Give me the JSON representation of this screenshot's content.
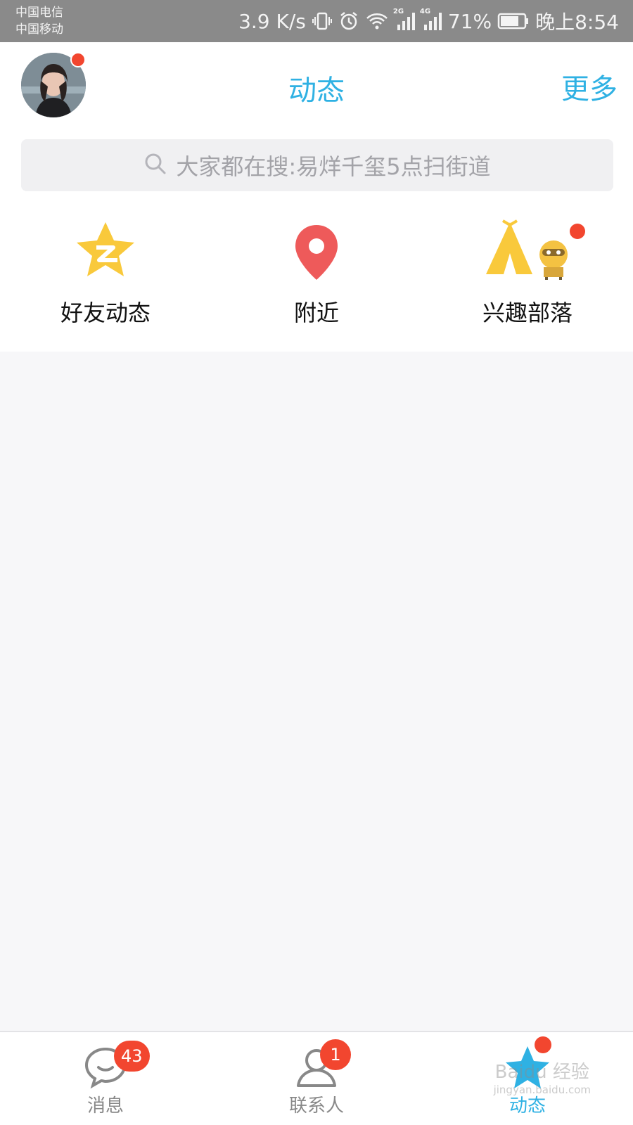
{
  "status_bar": {
    "carrier_1": "中国电信",
    "carrier_2": "中国移动",
    "net_speed": "3.9 K/s",
    "signal_1_tag": "2G",
    "signal_2_tag": "4G",
    "battery_percent": "71%",
    "time": "晚上8:54",
    "icons": [
      "vibrate-icon",
      "alarm-icon",
      "wifi-icon",
      "signal-icon",
      "battery-icon"
    ]
  },
  "header": {
    "title": "动态",
    "more_label": "更多",
    "avatar_has_notification": true
  },
  "search": {
    "placeholder": "大家都在搜:易烊千玺5点扫街道"
  },
  "features": [
    {
      "label": "好友动态",
      "icon": "qzone-star-icon"
    },
    {
      "label": "附近",
      "icon": "location-pin-icon"
    },
    {
      "label": "兴趣部落",
      "icon": "tribe-tent-icon",
      "has_notification": true
    }
  ],
  "tabs": [
    {
      "label": "消息",
      "icon": "chat-bubble-icon",
      "badge": "43",
      "active": false
    },
    {
      "label": "联系人",
      "icon": "contacts-icon",
      "badge": "1",
      "active": false
    },
    {
      "label": "动态",
      "icon": "star-icon",
      "has_dot": true,
      "active": true
    }
  ],
  "watermark": {
    "main": "Baidu 经验",
    "sub": "jingyan.baidu.com"
  },
  "colors": {
    "accent": "#2fb1e3",
    "badge": "#f2462f",
    "star_yellow": "#f9c93b",
    "pin_red": "#ee5a5a"
  }
}
